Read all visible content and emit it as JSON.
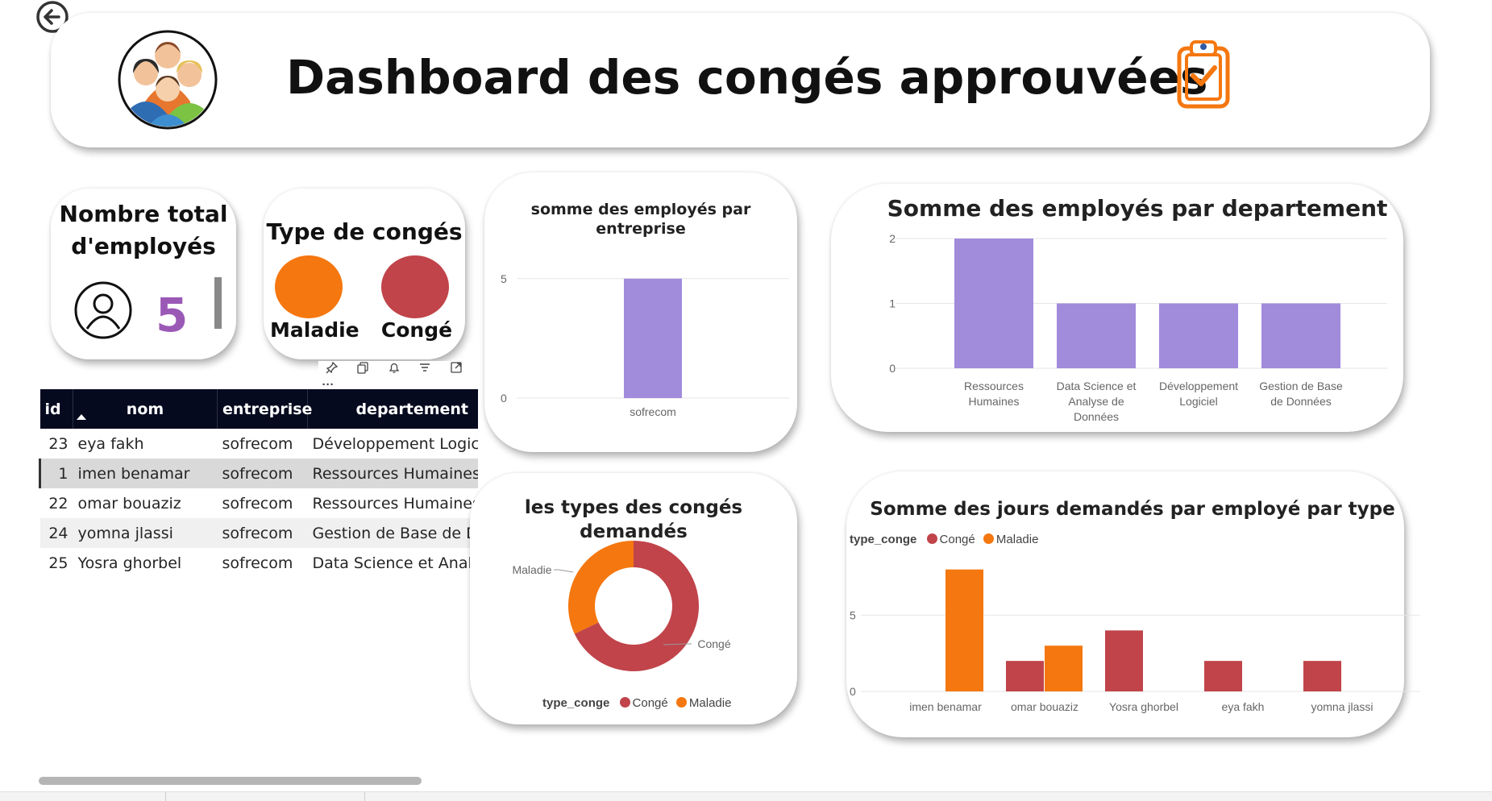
{
  "header": {
    "title": "Dashboard des congés approuvées",
    "back_icon": "back-arrow-icon",
    "logo_icon": "employees-group-icon",
    "clipboard_icon": "clipboard-check-icon"
  },
  "kpi": {
    "title": "Nombre total d'employés",
    "value": "5",
    "icon": "user-icon",
    "value_color": "#9b59b6"
  },
  "types": {
    "title": "Type de congés",
    "items": [
      {
        "label": "Maladie",
        "color": "#f5770f"
      },
      {
        "label": "Congé",
        "color": "#c0444a"
      }
    ]
  },
  "visual_toolbar": {
    "icons": [
      "pin-icon",
      "copy-icon",
      "bell-icon",
      "filter-icon",
      "focus-mode-icon",
      "more-options-icon"
    ],
    "more_label": "···"
  },
  "table": {
    "columns": [
      "id",
      "nom",
      "entreprise",
      "departement"
    ],
    "rows": [
      {
        "id": "23",
        "nom": "eya fakh",
        "entreprise": "sofrecom",
        "departement": "Développement Logiciel"
      },
      {
        "id": "1",
        "nom": "imen benamar",
        "entreprise": "sofrecom",
        "departement": "Ressources Humaines"
      },
      {
        "id": "22",
        "nom": "omar bouaziz",
        "entreprise": "sofrecom",
        "departement": "Ressources Humaines"
      },
      {
        "id": "24",
        "nom": "yomna jlassi",
        "entreprise": "sofrecom",
        "departement": "Gestion de Base de Données"
      },
      {
        "id": "25",
        "nom": "Yosra ghorbel",
        "entreprise": "sofrecom",
        "departement": "Data Science et Analyse de Données"
      }
    ]
  },
  "colors": {
    "purple": "#a18bdb",
    "conge": "#c0444a",
    "maladie": "#f5770f",
    "header_bg": "#050a1f"
  },
  "chart_data": [
    {
      "type": "bar",
      "title": "somme des employés par entreprise",
      "categories": [
        "sofrecom"
      ],
      "values": [
        5
      ],
      "yticks": [
        "0",
        "5"
      ],
      "ylim": [
        0,
        5.6
      ]
    },
    {
      "type": "bar",
      "title": "Somme des employés par departement",
      "categories": [
        "Ressources Humaines",
        "Data Science et Analyse de Données",
        "Développement Logiciel",
        "Gestion de Base de Données"
      ],
      "category_lines": [
        [
          "Ressources",
          "Humaines"
        ],
        [
          "Data Science et",
          "Analyse de",
          "Données"
        ],
        [
          "Développement",
          "Logiciel"
        ],
        [
          "Gestion de Base",
          "de Données"
        ]
      ],
      "values": [
        2,
        1,
        1,
        1
      ],
      "yticks": [
        "0",
        "1",
        "2"
      ],
      "ylim": [
        0,
        2
      ]
    },
    {
      "type": "pie",
      "title": "les types des congés demandés",
      "legend_title": "type_conge",
      "slices": [
        {
          "label": "Congé",
          "value": 68
        },
        {
          "label": "Maladie",
          "value": 32
        }
      ]
    },
    {
      "type": "bar",
      "title": "Somme des jours demandés par employé par type",
      "legend_title": "type_conge",
      "categories": [
        "imen benamar",
        "omar bouaziz",
        "Yosra ghorbel",
        "eya fakh",
        "yomna jlassi"
      ],
      "series": [
        {
          "name": "Congé",
          "values": [
            0,
            2,
            4,
            2,
            2
          ]
        },
        {
          "name": "Maladie",
          "values": [
            8,
            3,
            0,
            0,
            0
          ]
        }
      ],
      "yticks": [
        "0",
        "5"
      ],
      "ylim": [
        0,
        8.3
      ]
    }
  ]
}
